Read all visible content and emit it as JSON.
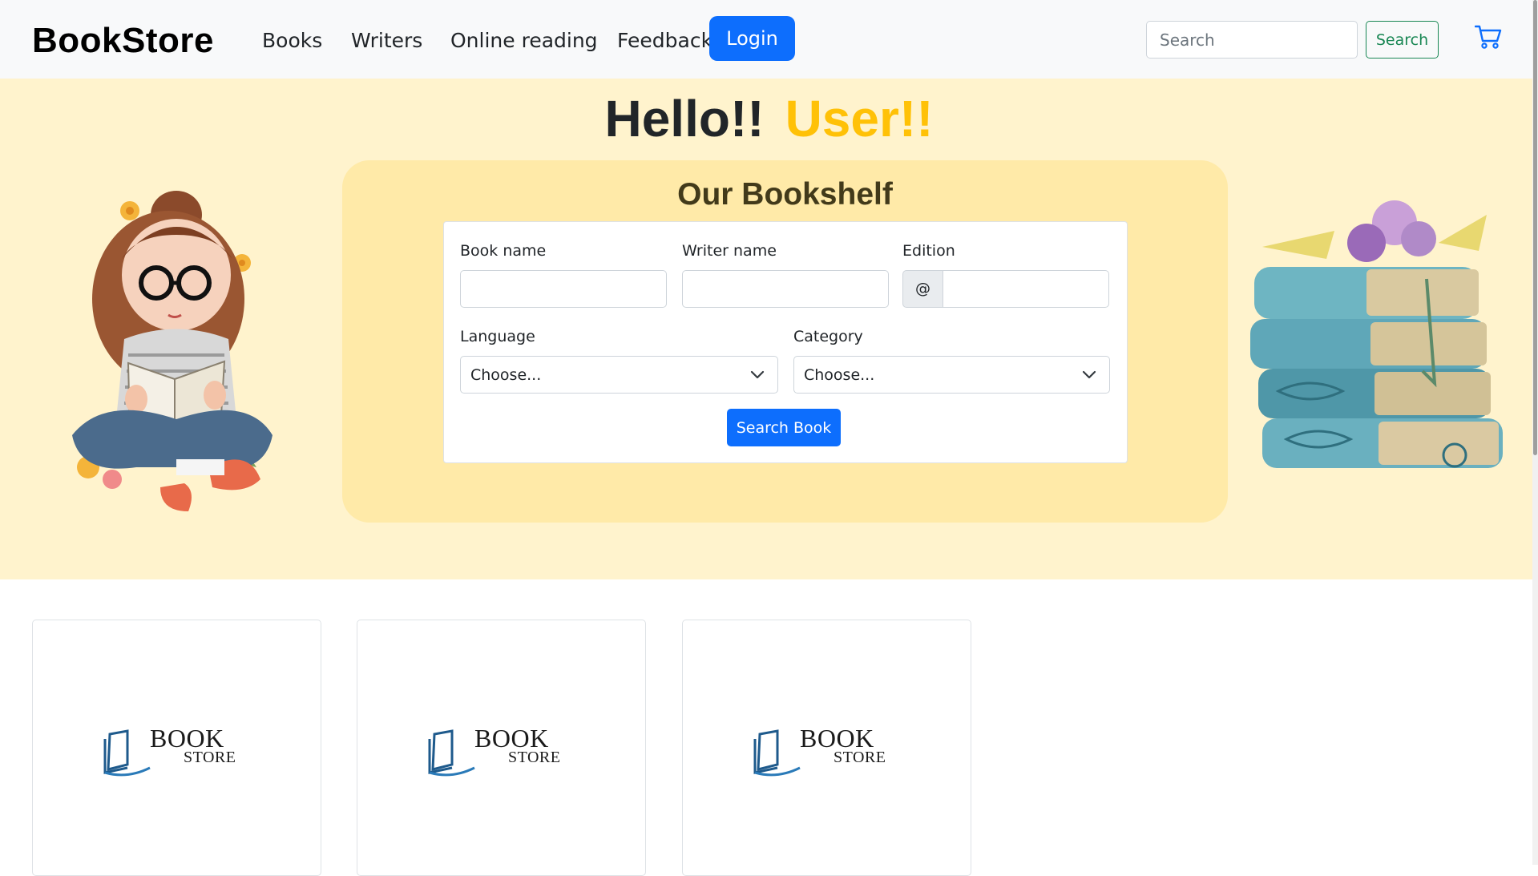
{
  "navbar": {
    "brand": "BookStore",
    "links": [
      "Books",
      "Writers",
      "Online reading",
      "Feedback"
    ],
    "login_label": "Login",
    "search_placeholder": "Search",
    "search_button": "Search",
    "cart_icon": "cart-icon"
  },
  "hero": {
    "greeting": "Hello!!",
    "user": "User!!",
    "bookshelf_title": "Our Bookshelf",
    "form": {
      "book_name_label": "Book name",
      "writer_name_label": "Writer name",
      "edition_label": "Edition",
      "edition_prefix": "@",
      "language_label": "Language",
      "language_selected": "Choose...",
      "category_label": "Category",
      "category_selected": "Choose...",
      "submit_label": "Search Book"
    }
  },
  "cards": [
    {
      "logo_top": "BOOK",
      "logo_bottom": "STORE"
    },
    {
      "logo_top": "BOOK",
      "logo_bottom": "STORE"
    },
    {
      "logo_top": "BOOK",
      "logo_bottom": "STORE"
    }
  ],
  "colors": {
    "primary": "#0d6efd",
    "success": "#198754",
    "warning": "#ffc107",
    "hero_bg": "#fff3cd",
    "shelf_bg": "#ffeaa8"
  }
}
